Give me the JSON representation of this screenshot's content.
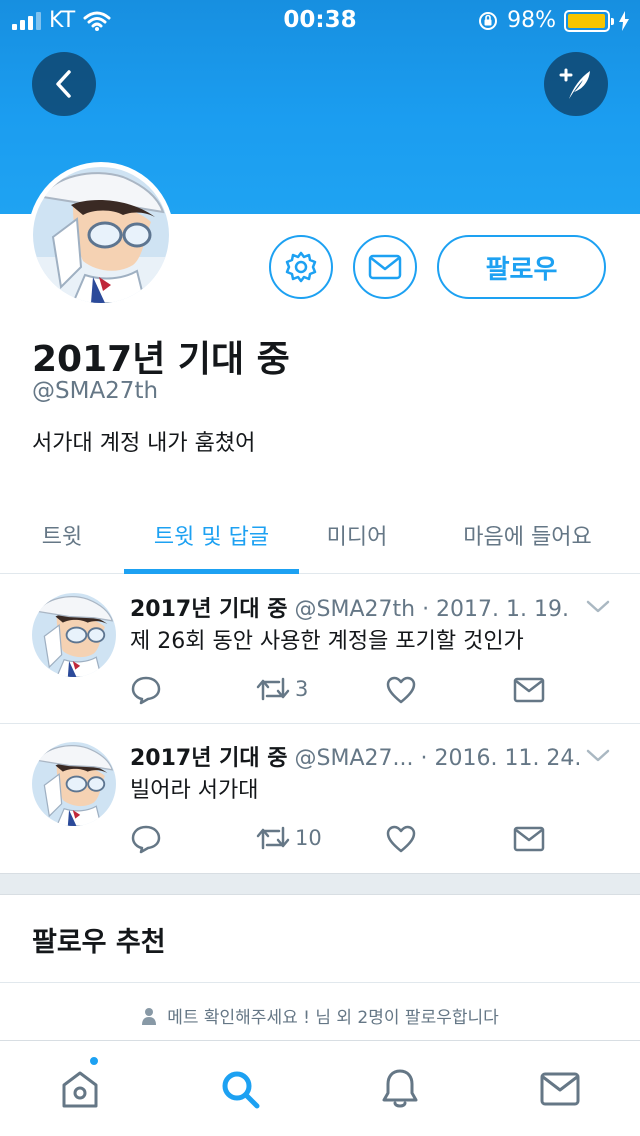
{
  "status_bar": {
    "carrier": "KT",
    "time": "00:38",
    "battery_percent": "98%",
    "battery_level": 0.98,
    "battery_color": "#f7c500"
  },
  "header": {
    "back_icon": "chevron-left-icon",
    "compose_icon": "compose-tweet-icon",
    "banner_color": "#1da1f2"
  },
  "profile": {
    "name": "2017년 기대 중",
    "handle": "@SMA27th",
    "bio": "서가대 계정 내가 훔쳤어",
    "settings_icon": "gear-icon",
    "message_icon": "envelope-icon",
    "follow_label": "팔로우"
  },
  "tabs": [
    {
      "label": "트윗",
      "active": false
    },
    {
      "label": "트윗 및 답글",
      "active": true
    },
    {
      "label": "미디어",
      "active": false
    },
    {
      "label": "마음에 들어요",
      "active": false
    }
  ],
  "tweets": [
    {
      "name": "2017년 기대 중",
      "handle": "@SMA27th",
      "date": " · 2017. 1. 19.",
      "text": "제 26회 동안 사용한 계정을 포기할 것인가",
      "retweets": "3",
      "replies": "",
      "likes": ""
    },
    {
      "name": "2017년 기대 중",
      "handle": "@SMA27...",
      "date": " · 2016. 11. 24.",
      "text": "빌어라 서가대",
      "retweets": "10",
      "replies": "",
      "likes": ""
    }
  ],
  "who_to_follow": {
    "title": "팔로우 추천",
    "social_context": "메트 확인해주세요 ! 님 외 2명이 팔로우합니다"
  },
  "bottom_tabs": [
    {
      "icon": "home-icon",
      "active": false,
      "has_notification_dot": true
    },
    {
      "icon": "search-icon",
      "active": true,
      "has_notification_dot": false
    },
    {
      "icon": "bell-icon",
      "active": false,
      "has_notification_dot": false
    },
    {
      "icon": "envelope-icon",
      "active": false,
      "has_notification_dot": false
    }
  ],
  "colors": {
    "accent": "#1da1f2",
    "text_primary": "#14171a",
    "text_secondary": "#657786"
  }
}
